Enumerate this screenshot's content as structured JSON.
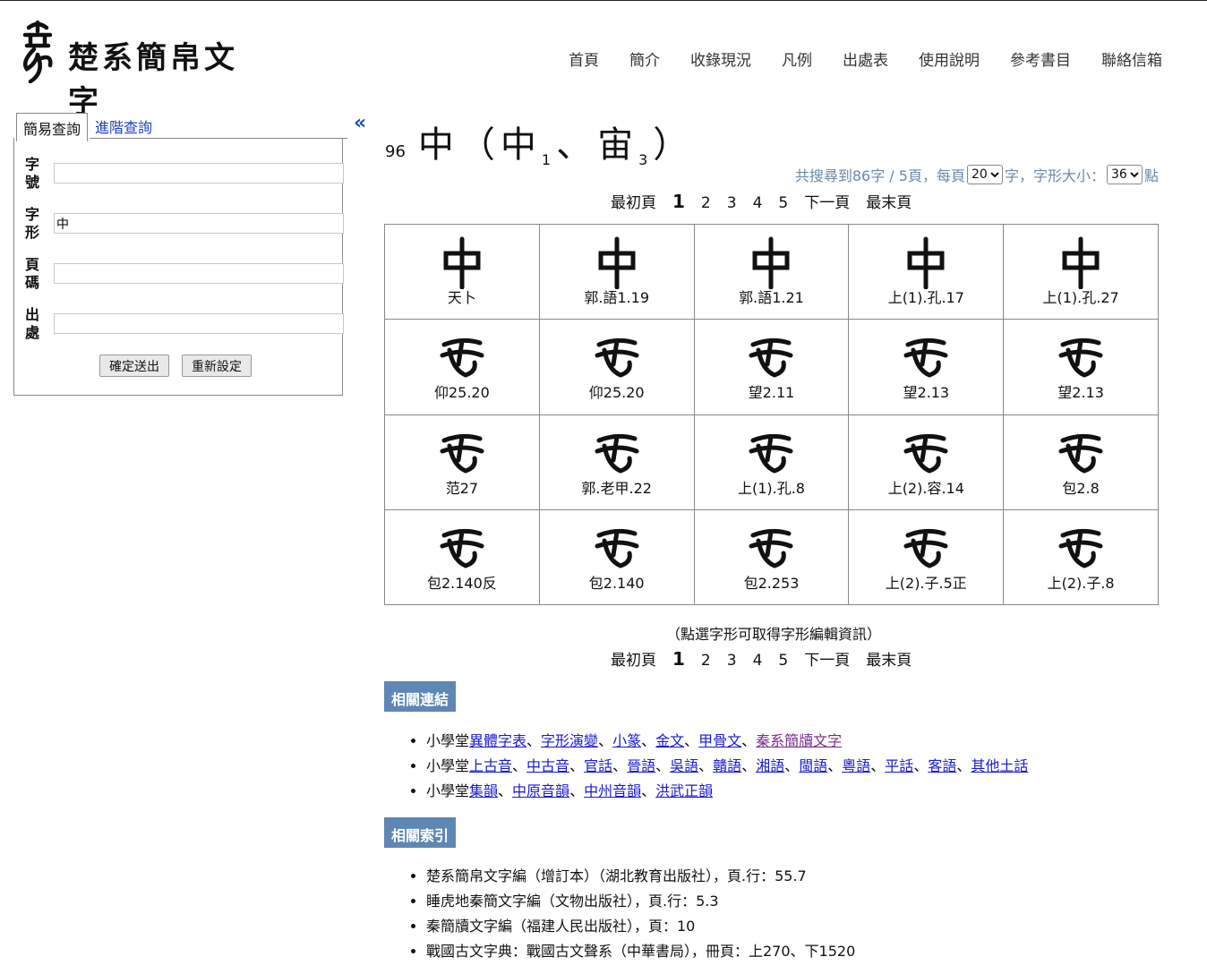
{
  "site": {
    "title": "楚系簡帛文字"
  },
  "nav": [
    "首頁",
    "簡介",
    "收錄現況",
    "凡例",
    "出處表",
    "使用說明",
    "參考書目",
    "聯絡信箱"
  ],
  "search": {
    "tab_simple": "簡易查詢",
    "tab_advanced": "進階查詢",
    "fields": [
      {
        "label": "字號",
        "value": ""
      },
      {
        "label": "字形",
        "value": "中"
      },
      {
        "label": "頁碼",
        "value": ""
      },
      {
        "label": "出處",
        "value": ""
      }
    ],
    "submit": "確定送出",
    "reset": "重新設定"
  },
  "collapse_icon": "«",
  "entry": {
    "number": "96",
    "main_char": "中",
    "variant1": "中",
    "sub1": "1",
    "variant2": "宙",
    "sub2": "3"
  },
  "summary": {
    "prefix": "共搜尋到86字 / 5頁，每頁",
    "per_page": "20",
    "mid": "字，字形大小：",
    "size": "36",
    "suffix": "點"
  },
  "pager": {
    "first": "最初頁",
    "pages": [
      "1",
      "2",
      "3",
      "4",
      "5"
    ],
    "current": "1",
    "next": "下一頁",
    "last": "最末頁"
  },
  "results": [
    "天卜",
    "郭.語1.19",
    "郭.語1.21",
    "上(1).孔.17",
    "上(1).孔.27",
    "仰25.20",
    "仰25.20",
    "望2.11",
    "望2.13",
    "望2.13",
    "范27",
    "郭.老甲.22",
    "上(1).孔.8",
    "上(2).容.14",
    "包2.8",
    "包2.140反",
    "包2.140",
    "包2.253",
    "上(2).子.5正",
    "上(2).子.8"
  ],
  "note": "（點選字形可取得字形編輯資訊）",
  "related_links": {
    "title": "相關連結",
    "rows": [
      {
        "prefix": "小學堂",
        "links": [
          "異體字表",
          "字形演變",
          "小篆",
          "金文",
          "甲骨文",
          "秦系簡牘文字"
        ]
      },
      {
        "prefix": "小學堂",
        "links": [
          "上古音",
          "中古音",
          "官話",
          "晉語",
          "吳語",
          "贛語",
          "湘語",
          "閩語",
          "粵語",
          "平話",
          "客語",
          "其他土話"
        ]
      },
      {
        "prefix": "小學堂",
        "links": [
          "集韻",
          "中原音韻",
          "中州音韻",
          "洪武正韻"
        ]
      }
    ]
  },
  "related_index": {
    "title": "相關索引",
    "items": [
      "楚系簡帛文字編（增訂本）（湖北教育出版社），頁.行：55.7",
      "睡虎地秦簡文字編（文物出版社），頁.行：5.3",
      "秦簡牘文字編（福建人民出版社），頁：10",
      "戰國古文字典：戰國古文聲系（中華書局），冊頁：上270、下1520"
    ]
  }
}
